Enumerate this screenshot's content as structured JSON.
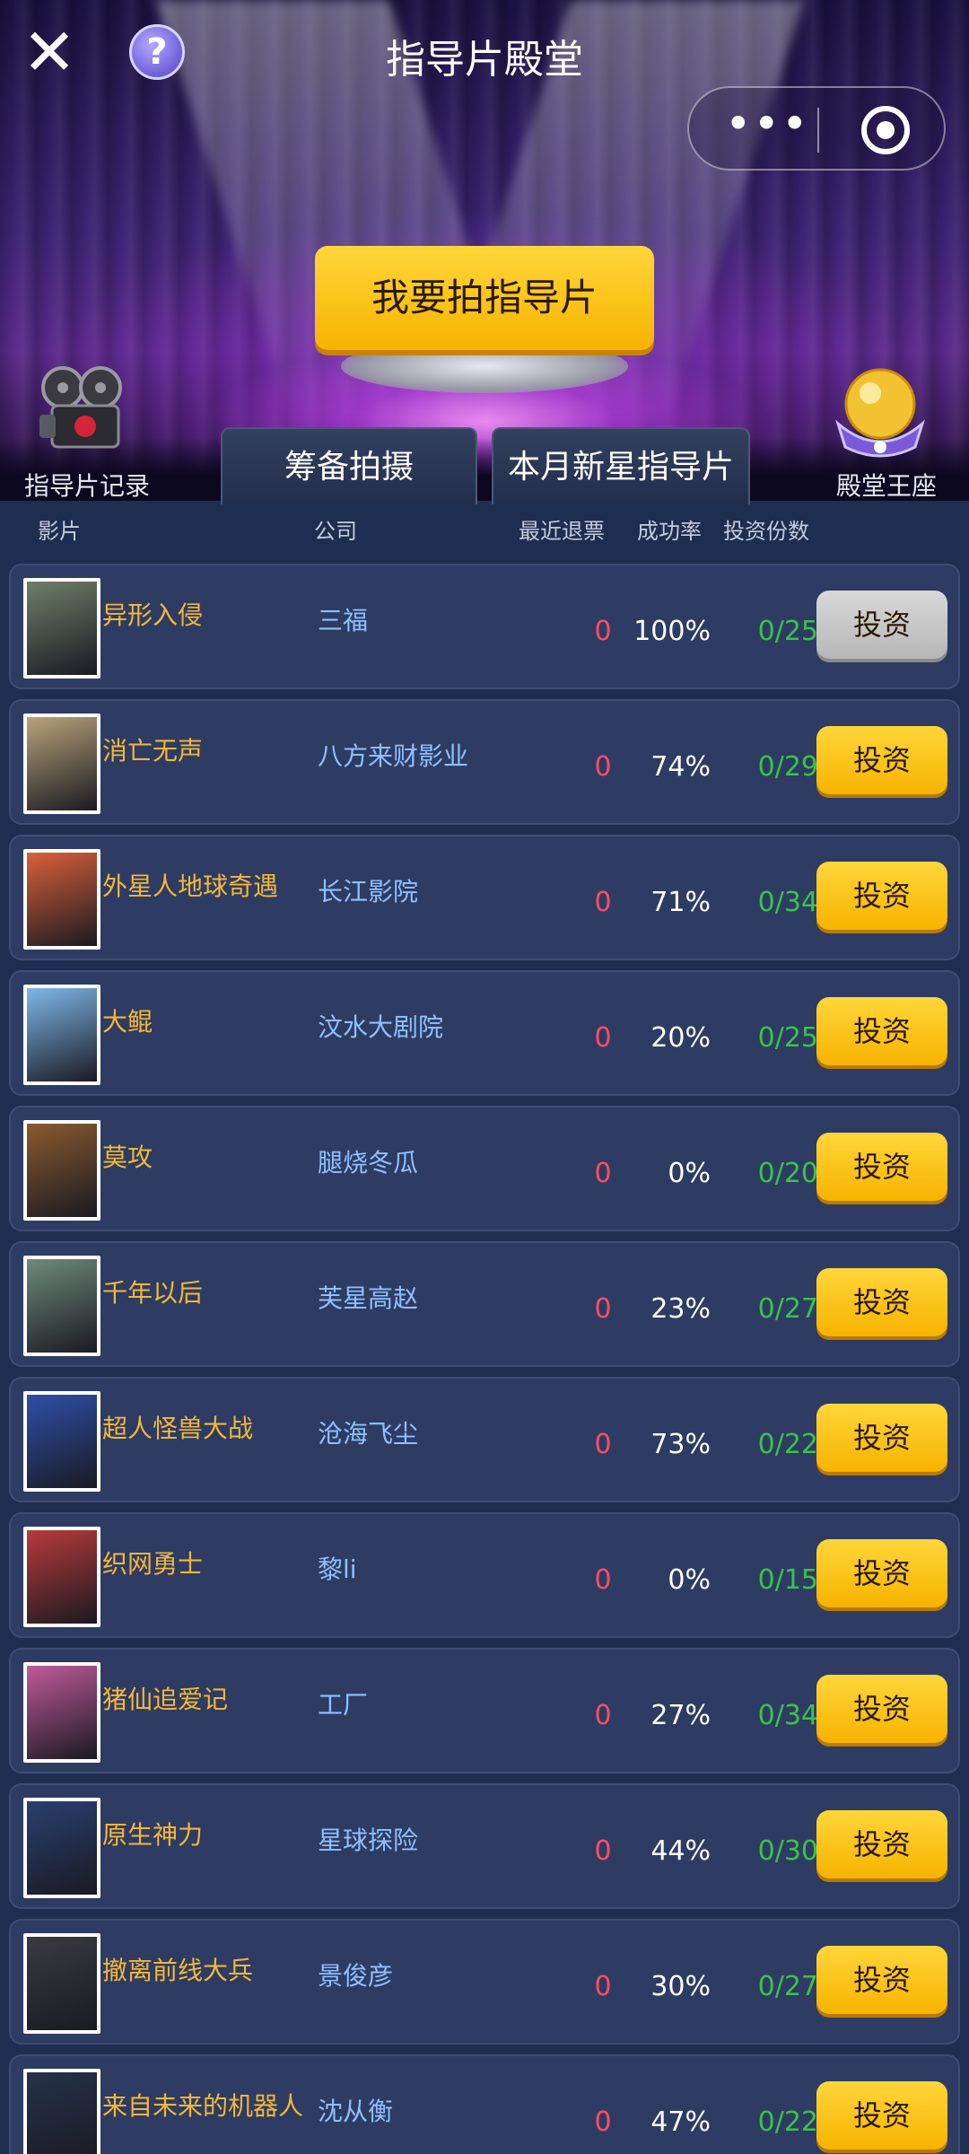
{
  "header": {
    "title": "指导片殿堂",
    "close_icon": "close-icon",
    "help_label": "?",
    "shoot_button": "我要拍指导片",
    "records_label": "指导片记录",
    "throne_label": "殿堂王座",
    "more_glyph": "•••"
  },
  "tabs": [
    {
      "label": "筹备拍摄"
    },
    {
      "label": "本月新星指导片"
    }
  ],
  "columns": {
    "movie": "影片",
    "company": "公司",
    "refund": "最近退票",
    "rate": "成功率",
    "shares": "投资份数"
  },
  "rows": [
    {
      "title": "异形入侵",
      "company": "三福",
      "refund": "0",
      "rate": "100%",
      "shares": "0/25",
      "button": "投资",
      "disabled": true,
      "poster": "#6f7f6a"
    },
    {
      "title": "消亡无声",
      "company": "八方来财影业",
      "refund": "0",
      "rate": "74%",
      "shares": "0/29",
      "button": "投资",
      "disabled": false,
      "poster": "#b8a37a"
    },
    {
      "title": "外星人地球奇遇",
      "company": "长江影院",
      "refund": "0",
      "rate": "71%",
      "shares": "0/34",
      "button": "投资",
      "disabled": false,
      "poster": "#d9603a"
    },
    {
      "title": "大鲲",
      "company": "汶水大剧院",
      "refund": "0",
      "rate": "20%",
      "shares": "0/25",
      "button": "投资",
      "disabled": false,
      "poster": "#7fb7e8"
    },
    {
      "title": "莫攻",
      "company": "腿烧冬瓜",
      "refund": "0",
      "rate": "0%",
      "shares": "0/20",
      "button": "投资",
      "disabled": false,
      "poster": "#8a5a30"
    },
    {
      "title": "千年以后",
      "company": "芙星高赵",
      "refund": "0",
      "rate": "23%",
      "shares": "0/27",
      "button": "投资",
      "disabled": false,
      "poster": "#6f8a7a"
    },
    {
      "title": "超人怪兽大战",
      "company": "沧海飞尘",
      "refund": "0",
      "rate": "73%",
      "shares": "0/22",
      "button": "投资",
      "disabled": false,
      "poster": "#2e4fa8"
    },
    {
      "title": "织网勇士",
      "company": "黎li",
      "refund": "0",
      "rate": "0%",
      "shares": "0/15",
      "button": "投资",
      "disabled": false,
      "poster": "#b83a3a"
    },
    {
      "title": "猪仙追爱记",
      "company": "工厂",
      "refund": "0",
      "rate": "27%",
      "shares": "0/34",
      "button": "投资",
      "disabled": false,
      "poster": "#c05a9a"
    },
    {
      "title": "原生神力",
      "company": "星球探险",
      "refund": "0",
      "rate": "44%",
      "shares": "0/30",
      "button": "投资",
      "disabled": false,
      "poster": "#2a3f70"
    },
    {
      "title": "撤离前线大兵",
      "company": "景俊彦",
      "refund": "0",
      "rate": "30%",
      "shares": "0/27",
      "button": "投资",
      "disabled": false,
      "poster": "#3a3a40"
    },
    {
      "title": "来自未来的机器人",
      "company": "沈从衡",
      "refund": "0",
      "rate": "47%",
      "shares": "0/22",
      "button": "投资",
      "disabled": false,
      "poster": "#25324a"
    }
  ]
}
